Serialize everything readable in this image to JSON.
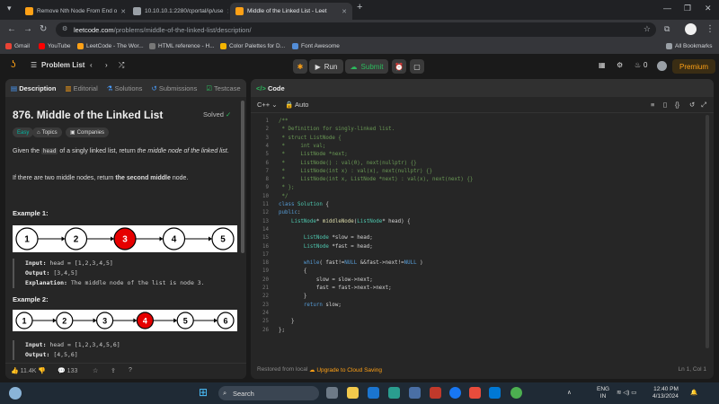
{
  "browser": {
    "tabs": [
      {
        "title": "Remove Nth Node From End o",
        "active": false
      },
      {
        "title": "10.10.10.1:2280/cportal/ip/use",
        "active": false
      },
      {
        "title": "Middle of the Linked List - Leet",
        "active": true
      }
    ],
    "url_host": "leetcode.com",
    "url_path": "/problems/middle-of-the-linked-list/description/",
    "bookmarks": [
      "Gmail",
      "YouTube",
      "LeetCode - The Wor...",
      "HTML reference - H...",
      "Color Palettes for D...",
      "Font Awesome"
    ],
    "all_bookmarks": "All Bookmarks"
  },
  "nav": {
    "problem_list": "Problem List",
    "run": "Run",
    "submit": "Submit",
    "streak": "0",
    "premium": "Premium"
  },
  "left": {
    "tabs": [
      "Description",
      "Editorial",
      "Solutions",
      "Submissions",
      "Testcase"
    ],
    "title": "876. Middle of the Linked List",
    "status": "Solved",
    "chips": [
      "Easy",
      "Topics",
      "Companies"
    ],
    "desc1_a": "Given the ",
    "desc1_code": "head",
    "desc1_b": " of a singly linked list, return ",
    "desc1_em": "the middle node of the linked list",
    "desc1_c": ".",
    "desc2_a": "If there are two middle nodes, return ",
    "desc2_b": "the second middle",
    "desc2_c": " node.",
    "ex1": {
      "heading": "Example 1:",
      "nodes": [
        "1",
        "2",
        "3",
        "4",
        "5"
      ],
      "highlight": 2,
      "input_label": "Input:",
      "input": "head = [1,2,3,4,5]",
      "output_label": "Output:",
      "output": "[3,4,5]",
      "expl_label": "Explanation:",
      "expl": "The middle node of the list is node 3."
    },
    "ex2": {
      "heading": "Example 2:",
      "nodes": [
        "1",
        "2",
        "3",
        "4",
        "5",
        "6"
      ],
      "highlight": 3,
      "input_label": "Input:",
      "input": "head = [1,2,3,4,5,6]",
      "output_label": "Output:",
      "output": "[4,5,6]"
    },
    "likes": "11.4K",
    "comments": "133"
  },
  "right": {
    "header": "Code",
    "lang": "C++",
    "mode": "Auto",
    "footer_left": "Restored from local",
    "upgrade": "Upgrade to Cloud Saving",
    "cursor": "Ln 1, Col 1",
    "code": [
      "/**",
      " * Definition for singly-linked list.",
      " * struct ListNode {",
      " *     int val;",
      " *     ListNode *next;",
      " *     ListNode() : val(0), next(nullptr) {}",
      " *     ListNode(int x) : val(x), next(nullptr) {}",
      " *     ListNode(int x, ListNode *next) : val(x), next(next) {}",
      " * };",
      " */",
      "class Solution {",
      "public:",
      "    ListNode* middleNode(ListNode* head) {",
      "",
      "        ListNode *slow = head;",
      "        ListNode *fast = head;",
      "",
      "        while( fast!=NULL &&fast->next!=NULL )",
      "        {",
      "            slow = slow->next;",
      "            fast = fast->next->next;",
      "        }",
      "        return slow;",
      "",
      "    }",
      "};"
    ]
  },
  "taskbar": {
    "search": "Search",
    "lang1": "ENG",
    "lang2": "IN",
    "time": "12:40 PM",
    "date": "4/13/2024"
  },
  "colors": {
    "accent": "#ffa116",
    "run_green": "#2cbb5d",
    "highlight_node": "#e60000"
  }
}
